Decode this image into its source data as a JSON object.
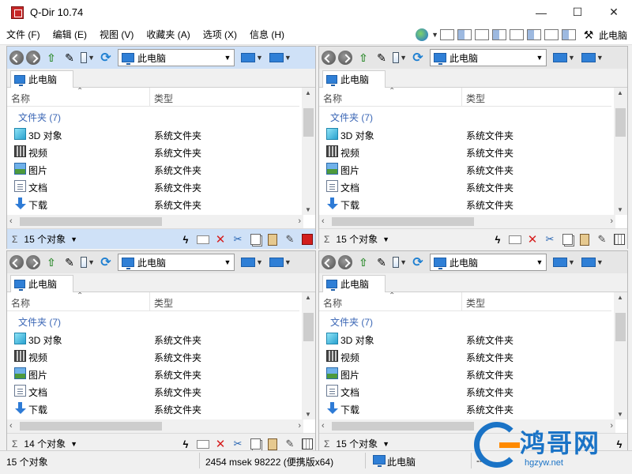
{
  "window": {
    "title": "Q-Dir 10.74",
    "minimize": "—",
    "maximize": "☐",
    "close": "✕"
  },
  "menu": {
    "items": [
      "文件 (F)",
      "编辑 (E)",
      "视图 (V)",
      "收藏夹 (A)",
      "选项 (X)",
      "信息 (H)"
    ],
    "location_label": "此电脑"
  },
  "panes": [
    {
      "active": true,
      "address": "此电脑",
      "tab": "此电脑",
      "columns": {
        "name": "名称",
        "type": "类型"
      },
      "group": "文件夹 (7)",
      "rows": [
        {
          "name": "3D 对象",
          "type": "系统文件夹",
          "icon": "3d-objects-icon"
        },
        {
          "name": "视频",
          "type": "系统文件夹",
          "icon": "video-folder-icon"
        },
        {
          "name": "图片",
          "type": "系统文件夹",
          "icon": "pictures-folder-icon"
        },
        {
          "name": "文档",
          "type": "系统文件夹",
          "icon": "documents-folder-icon"
        },
        {
          "name": "下载",
          "type": "系统文件夹",
          "icon": "downloads-folder-icon"
        }
      ],
      "count": "15 个对象"
    },
    {
      "active": false,
      "address": "此电脑",
      "tab": "此电脑",
      "columns": {
        "name": "名称",
        "type": "类型"
      },
      "group": "文件夹 (7)",
      "rows": [
        {
          "name": "3D 对象",
          "type": "系统文件夹",
          "icon": "3d-objects-icon"
        },
        {
          "name": "视频",
          "type": "系统文件夹",
          "icon": "video-folder-icon"
        },
        {
          "name": "图片",
          "type": "系统文件夹",
          "icon": "pictures-folder-icon"
        },
        {
          "name": "文档",
          "type": "系统文件夹",
          "icon": "documents-folder-icon"
        },
        {
          "name": "下载",
          "type": "系统文件夹",
          "icon": "downloads-folder-icon"
        }
      ],
      "count": "15 个对象"
    },
    {
      "active": false,
      "address": "此电脑",
      "tab": "此电脑",
      "columns": {
        "name": "名称",
        "type": "类型"
      },
      "group": "文件夹 (7)",
      "rows": [
        {
          "name": "3D 对象",
          "type": "系统文件夹",
          "icon": "3d-objects-icon"
        },
        {
          "name": "视频",
          "type": "系统文件夹",
          "icon": "video-folder-icon"
        },
        {
          "name": "图片",
          "type": "系统文件夹",
          "icon": "pictures-folder-icon"
        },
        {
          "name": "文档",
          "type": "系统文件夹",
          "icon": "documents-folder-icon"
        },
        {
          "name": "下载",
          "type": "系统文件夹",
          "icon": "downloads-folder-icon"
        }
      ],
      "count": "14 个对象"
    },
    {
      "active": false,
      "address": "此电脑",
      "tab": "此电脑",
      "columns": {
        "name": "名称",
        "type": "类型"
      },
      "group": "文件夹 (7)",
      "rows": [
        {
          "name": "3D 对象",
          "type": "系统文件夹",
          "icon": "3d-objects-icon"
        },
        {
          "name": "视频",
          "type": "系统文件夹",
          "icon": "video-folder-icon"
        },
        {
          "name": "图片",
          "type": "系统文件夹",
          "icon": "pictures-folder-icon"
        },
        {
          "name": "文档",
          "type": "系统文件夹",
          "icon": "documents-folder-icon"
        },
        {
          "name": "下载",
          "type": "系统文件夹",
          "icon": "downloads-folder-icon"
        }
      ],
      "count": "15 个对象"
    }
  ],
  "status_bar": {
    "count": "15 个对象",
    "info": "2454 msek 98222 (便携版x64)",
    "location": "此电脑",
    "extra": "--"
  },
  "watermark": {
    "text": "鸿哥网",
    "url": "hgzyw.net"
  },
  "colors": {
    "active_pane": "#cfe1f7",
    "inactive_pane": "#e6e6e6",
    "group_label": "#3a66b5",
    "delete_red": "#d61d1d",
    "brand_blue": "#1a73c6"
  }
}
